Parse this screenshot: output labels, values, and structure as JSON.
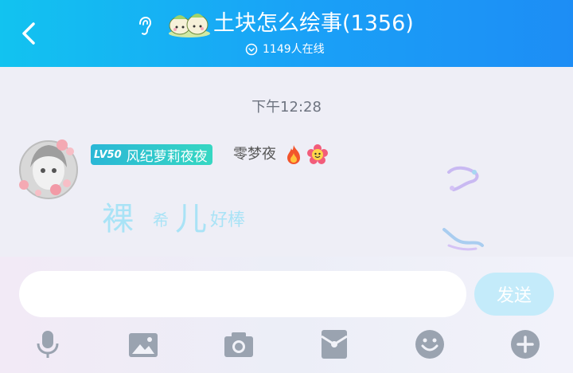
{
  "header": {
    "title": "土块怎么绘事(1356)",
    "online_count": "1149人在线",
    "group_emoji": "dumplings-emoji"
  },
  "chat": {
    "timestamp": "下午12:28",
    "message": {
      "level": "LV50",
      "badge_title": "风纪萝莉夜夜",
      "nickname": "零梦夜",
      "icons": [
        "fire-icon",
        "flower-emoji"
      ],
      "text_chars": [
        "裸",
        "希",
        "儿",
        "好棒"
      ]
    }
  },
  "input": {
    "placeholder": "",
    "send_label": "发送"
  },
  "toolbar": {
    "items": [
      "microphone-icon",
      "image-icon",
      "camera-icon",
      "red-packet-icon",
      "emoji-icon",
      "plus-icon"
    ]
  },
  "colors": {
    "header_start": "#12c3f0",
    "header_end": "#1d8df5",
    "message_text": "#a9e3f6",
    "send_button": "#c4ebfa",
    "toolbar_icon": "#9aa3b0"
  }
}
